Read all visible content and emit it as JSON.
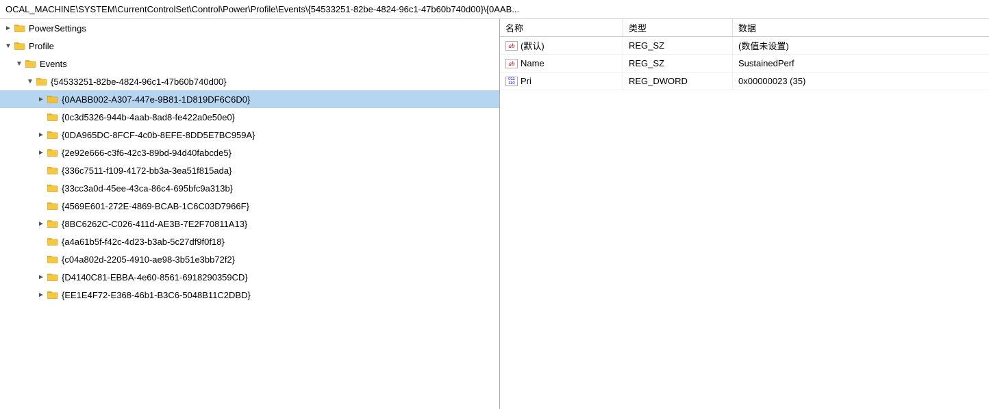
{
  "topbar": {
    "path": "OCAL_MACHINE\\SYSTEM\\CurrentControlSet\\Control\\Power\\Profile\\Events\\{54533251-82be-4824-96c1-47b60b740d00}\\{0AAB..."
  },
  "tree": {
    "items": [
      {
        "id": "power-settings",
        "indent": 0,
        "label": "PowerSettings",
        "expanded": false,
        "hasChildren": true,
        "selected": false
      },
      {
        "id": "profile",
        "indent": 0,
        "label": "Profile",
        "expanded": true,
        "hasChildren": true,
        "selected": false
      },
      {
        "id": "events",
        "indent": 1,
        "label": "Events",
        "expanded": true,
        "hasChildren": true,
        "selected": false
      },
      {
        "id": "guid-54533251",
        "indent": 2,
        "label": "{54533251-82be-4824-96c1-47b60b740d00}",
        "expanded": true,
        "hasChildren": true,
        "selected": false
      },
      {
        "id": "guid-0AABB002",
        "indent": 3,
        "label": "{0AABB002-A307-447e-9B81-1D819DF6C6D0}",
        "expanded": false,
        "hasChildren": true,
        "selected": true
      },
      {
        "id": "guid-0c3d5326",
        "indent": 3,
        "label": "{0c3d5326-944b-4aab-8ad8-fe422a0e50e0}",
        "expanded": false,
        "hasChildren": false,
        "selected": false
      },
      {
        "id": "guid-0DA965DC",
        "indent": 3,
        "label": "{0DA965DC-8FCF-4c0b-8EFE-8DD5E7BC959A}",
        "expanded": false,
        "hasChildren": true,
        "selected": false
      },
      {
        "id": "guid-2e92e666",
        "indent": 3,
        "label": "{2e92e666-c3f6-42c3-89bd-94d40fabcde5}",
        "expanded": false,
        "hasChildren": true,
        "selected": false
      },
      {
        "id": "guid-336c7511",
        "indent": 3,
        "label": "{336c7511-f109-4172-bb3a-3ea51f815ada}",
        "expanded": false,
        "hasChildren": false,
        "selected": false
      },
      {
        "id": "guid-33cc3a0d",
        "indent": 3,
        "label": "{33cc3a0d-45ee-43ca-86c4-695bfc9a313b}",
        "expanded": false,
        "hasChildren": false,
        "selected": false
      },
      {
        "id": "guid-4569E601",
        "indent": 3,
        "label": "{4569E601-272E-4869-BCAB-1C6C03D7966F}",
        "expanded": false,
        "hasChildren": false,
        "selected": false
      },
      {
        "id": "guid-8BC6262C",
        "indent": 3,
        "label": "{8BC6262C-C026-411d-AE3B-7E2F70811A13}",
        "expanded": false,
        "hasChildren": true,
        "selected": false
      },
      {
        "id": "guid-a4a61b5f",
        "indent": 3,
        "label": "{a4a61b5f-f42c-4d23-b3ab-5c27df9f0f18}",
        "expanded": false,
        "hasChildren": false,
        "selected": false
      },
      {
        "id": "guid-c04a802d",
        "indent": 3,
        "label": "{c04a802d-2205-4910-ae98-3b51e3bb72f2}",
        "expanded": false,
        "hasChildren": false,
        "selected": false
      },
      {
        "id": "guid-D4140C81",
        "indent": 3,
        "label": "{D4140C81-EBBA-4e60-8561-6918290359CD}",
        "expanded": false,
        "hasChildren": true,
        "selected": false
      },
      {
        "id": "guid-EE1E4F72",
        "indent": 3,
        "label": "{EE1E4F72-E368-46b1-B3C6-5048B11C2DBD}",
        "expanded": false,
        "hasChildren": true,
        "selected": false
      }
    ]
  },
  "values": {
    "headers": {
      "name": "名称",
      "type": "类型",
      "data": "数据"
    },
    "rows": [
      {
        "id": "default",
        "nameIcon": "ab",
        "name": "(默认)",
        "type": "REG_SZ",
        "data": "(数值未设置)"
      },
      {
        "id": "name",
        "nameIcon": "ab",
        "name": "Name",
        "type": "REG_SZ",
        "data": "SustainedPerf"
      },
      {
        "id": "pri",
        "nameIcon": "bin",
        "name": "Pri",
        "type": "REG_DWORD",
        "data": "0x00000023 (35)"
      }
    ]
  }
}
